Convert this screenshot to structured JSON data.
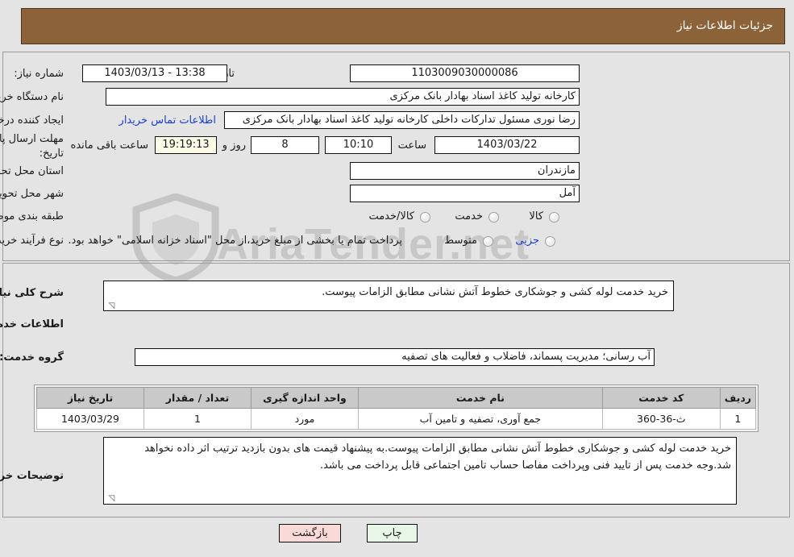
{
  "header": {
    "title": "جزئیات اطلاعات نیاز"
  },
  "top_section": {
    "fields": {
      "need_number_label": "شماره نیاز:",
      "need_number_value": "1103009030000086",
      "announce_datetime_label": "تاریخ و ساعت اعلان عمومی:",
      "announce_datetime_value": "13:38 - 1403/03/13",
      "buyer_org_label": "نام دستگاه خریدار:",
      "buyer_org_value": "کارخانه تولید کاغذ اسناد بهادار بانک مرکزی",
      "requester_label": "ایجاد کننده درخواست:",
      "requester_value": "رضا نوری مسئول تدارکات داخلی کارخانه تولید کاغذ اسناد بهادار بانک مرکزی",
      "buyer_contact_link": "اطلاعات تماس خریدار",
      "deadline_label_line1": "مهلت ارسال پاسخ: تا",
      "deadline_label_line2": "تاریخ:",
      "deadline_date": "1403/03/22",
      "hour_label": "ساعت",
      "deadline_time": "10:10",
      "days_remaining": "8",
      "days_label": "روز و",
      "time_remaining": "19:19:13",
      "time_remaining_label": "ساعت باقی مانده",
      "province_label": "استان محل تحویل:",
      "province_value": "مازندران",
      "city_label": "شهر محل تحویل:",
      "city_value": "آمل"
    },
    "category": {
      "label": "طبقه بندی موضوعی:",
      "options": [
        {
          "label": "کالا",
          "checked": false
        },
        {
          "label": "خدمت",
          "checked": false
        },
        {
          "label": "کالا/خدمت",
          "checked": false
        }
      ]
    },
    "purchase_type": {
      "label": "نوع فرآیند خرید :",
      "options": [
        {
          "label": "جزیی",
          "checked": false,
          "blue": true
        },
        {
          "label": "متوسط",
          "checked": false,
          "blue": false
        }
      ],
      "note": "پرداخت تمام یا بخشی از مبلغ خرید،از محل \"اسناد خزانه اسلامی\" خواهد بود."
    }
  },
  "bottom_section": {
    "general_desc_label": "شرح کلی نیاز:",
    "general_desc_value": "خرید خدمت لوله کشی و جوشکاری خطوط آتش نشانی مطابق الزامات پیوست.",
    "services_info_heading": "اطلاعات خدمات مورد نیاز",
    "service_group_label": "گروه خدمت:",
    "service_group_value": "آب رسانی؛ مدیریت پسماند، فاضلاب و فعالیت های تصفیه",
    "buyer_notes_label": "توضیحات خریدار:",
    "buyer_notes_value": "خرید خدمت لوله کشی و جوشکاری خطوط آتش نشانی مطابق الزامات پیوست.به پیشنهاد قیمت های بدون بازدید ترتیب اثر داده نخواهد شد.وجه خدمت پس از تایید فنی وپرداخت مفاصا حساب تامین اجتماعی قابل پرداخت می باشد."
  },
  "table": {
    "headers": [
      "ردیف",
      "کد خدمت",
      "نام خدمت",
      "واحد اندازه گیری",
      "تعداد / مقدار",
      "تاریخ نیاز"
    ],
    "rows": [
      {
        "row_no": "1",
        "service_code": "ث-36-360",
        "service_name": "جمع آوری، تصفیه و تامین آب",
        "unit": "مورد",
        "quantity": "1",
        "need_date": "1403/03/29"
      }
    ]
  },
  "footer": {
    "print_label": "چاپ",
    "back_label": "بازگشت"
  },
  "watermark": {
    "text": "AriaTender.net"
  },
  "colors": {
    "header_bg": "#8c6239",
    "page_bg": "#e4e4e4",
    "link": "#1a3fd0",
    "table_header_bg": "#c9c9c9",
    "print_btn_bg": "#e8f6e8",
    "back_btn_bg": "#fad9d9",
    "cream_field_bg": "#fcfbe8"
  }
}
